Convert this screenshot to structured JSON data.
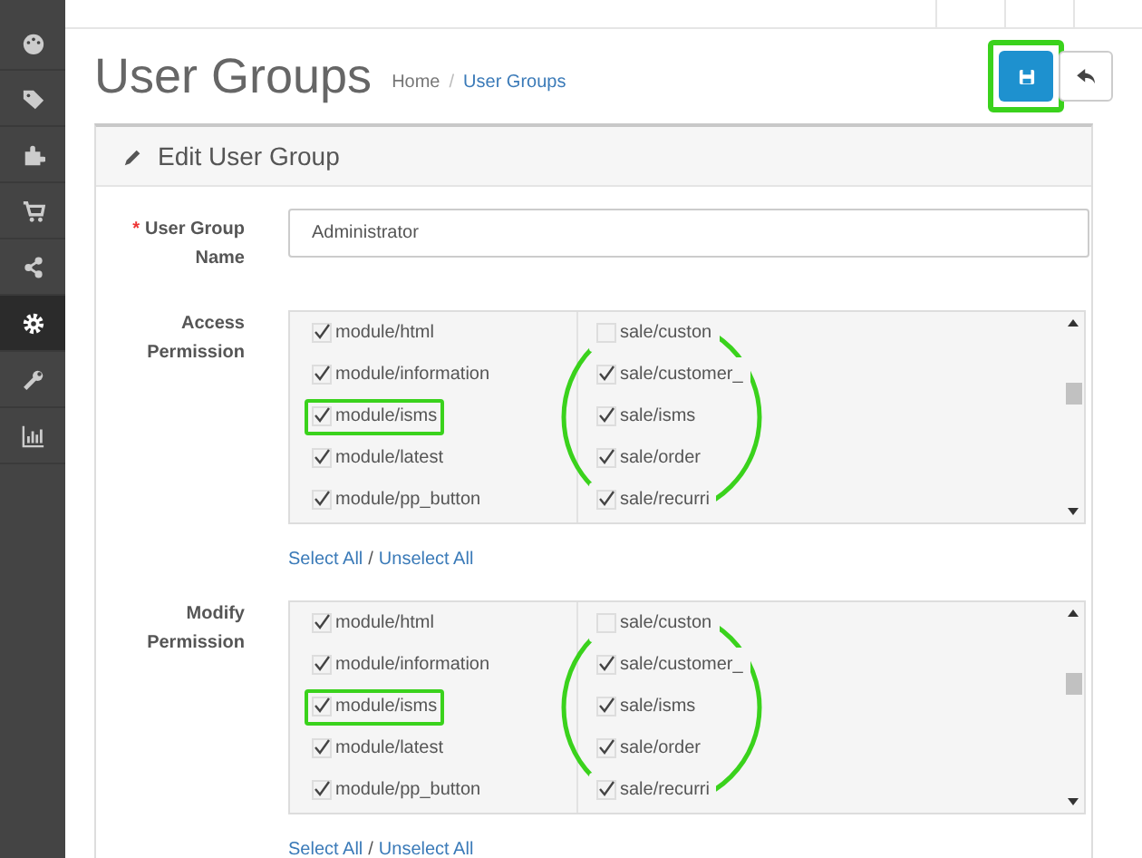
{
  "sidebar": {
    "items": [
      {
        "selected": false
      },
      {
        "selected": false
      },
      {
        "selected": false
      },
      {
        "selected": false
      },
      {
        "selected": false
      },
      {
        "selected": true
      },
      {
        "selected": false
      },
      {
        "selected": false
      }
    ]
  },
  "header": {
    "title": "User Groups",
    "breadcrumb": [
      {
        "label": "Home",
        "current": false
      },
      {
        "label": "User Groups",
        "current": true
      }
    ],
    "breadcrumb_separator": "/",
    "buttons": [
      {
        "kind": "save",
        "highlighted": true
      },
      {
        "kind": "back",
        "highlighted": false
      }
    ]
  },
  "panel": {
    "title": "Edit User Group",
    "group_name": {
      "label": "User Group Name",
      "required_mark": "*",
      "value": "Administrator"
    },
    "permissions": [
      {
        "label": "Access Permission",
        "columns": [
          {
            "circled": false,
            "items": [
              {
                "label": "module/html",
                "checked": true,
                "highlighted": false
              },
              {
                "label": "module/information",
                "checked": true,
                "highlighted": false
              },
              {
                "label": "module/isms",
                "checked": true,
                "highlighted": true
              },
              {
                "label": "module/latest",
                "checked": true,
                "highlighted": false
              },
              {
                "label": "module/pp_button",
                "checked": true,
                "highlighted": false
              }
            ]
          },
          {
            "circled": true,
            "items": [
              {
                "label": "sale/custon",
                "checked": false,
                "highlighted": false
              },
              {
                "label": "sale/customer_",
                "checked": true,
                "highlighted": false
              },
              {
                "label": "sale/isms",
                "checked": true,
                "highlighted": false
              },
              {
                "label": "sale/order",
                "checked": true,
                "highlighted": false
              },
              {
                "label": "sale/recurri",
                "checked": true,
                "highlighted": false
              }
            ]
          }
        ],
        "links": [
          "Select All",
          "Unselect All"
        ],
        "separator": "/"
      },
      {
        "label": "Modify Permission",
        "columns": [
          {
            "circled": false,
            "items": [
              {
                "label": "module/html",
                "checked": true,
                "highlighted": false
              },
              {
                "label": "module/information",
                "checked": true,
                "highlighted": false
              },
              {
                "label": "module/isms",
                "checked": true,
                "highlighted": true
              },
              {
                "label": "module/latest",
                "checked": true,
                "highlighted": false
              },
              {
                "label": "module/pp_button",
                "checked": true,
                "highlighted": false
              }
            ]
          },
          {
            "circled": true,
            "items": [
              {
                "label": "sale/custon",
                "checked": false,
                "highlighted": false
              },
              {
                "label": "sale/customer_",
                "checked": true,
                "highlighted": false
              },
              {
                "label": "sale/isms",
                "checked": true,
                "highlighted": false
              },
              {
                "label": "sale/order",
                "checked": true,
                "highlighted": false
              },
              {
                "label": "sale/recurri",
                "checked": true,
                "highlighted": false
              }
            ]
          }
        ],
        "links": [
          "Select All",
          "Unselect All"
        ],
        "separator": "/"
      }
    ]
  }
}
